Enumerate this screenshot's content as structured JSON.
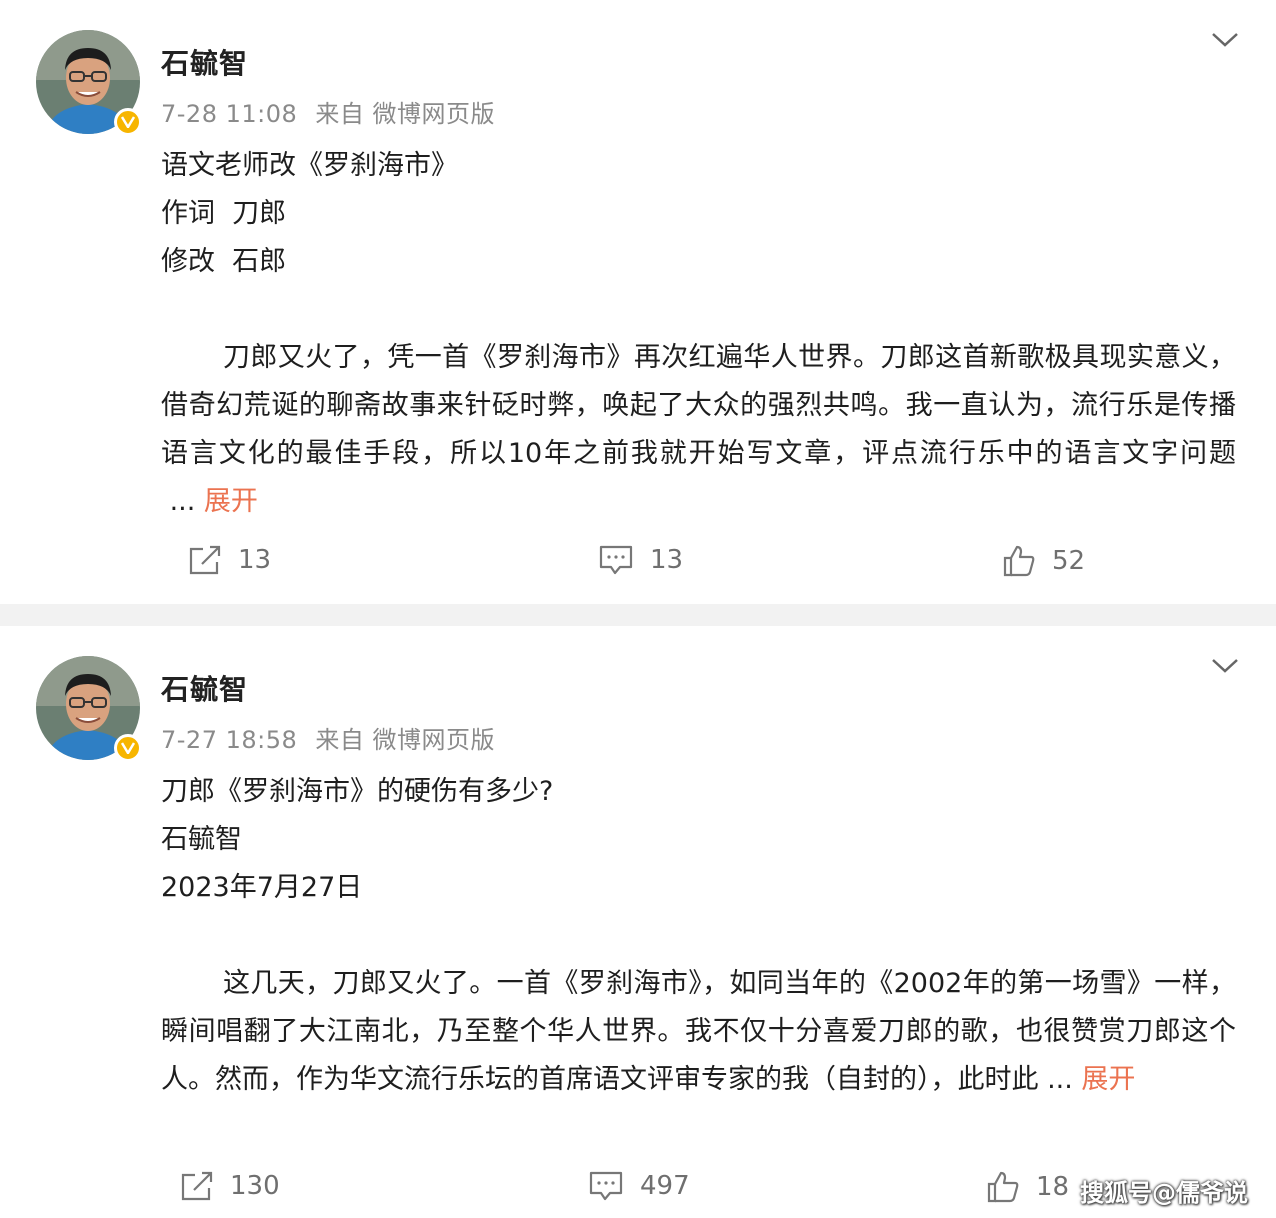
{
  "posts": [
    {
      "author": "石毓智",
      "time": "7-28 11:08",
      "source": "来自 微博网页版",
      "lines": [
        "语文老师改《罗刹海市》",
        "作词  刀郎",
        "修改  石郎"
      ],
      "body": "刀郎又火了，凭一首《罗刹海市》再次红遍华人世界。刀郎这首新歌极具现实意义，借奇幻荒诞的聊斋故事来针砭时弊，唤起了大众的强烈共鸣。我一直认为，流行乐是传播语言文化的最佳手段，所以10年之前我就开始写文章，评点流行乐中的语言文字问题",
      "ellipsis": " ... ",
      "expand_label": "展开",
      "reposts": "13",
      "comments": "13",
      "likes": "52"
    },
    {
      "author": "石毓智",
      "time": "7-27 18:58",
      "source": "来自 微博网页版",
      "lines": [
        "刀郎《罗刹海市》的硬伤有多少?",
        "石毓智",
        "2023年7月27日"
      ],
      "body": "这几天，刀郎又火了。一首《罗刹海市》，如同当年的《2002年的第一场雪》一样，瞬间唱翻了大江南北，乃至整个华人世界。我不仅十分喜爱刀郎的歌，也很赞赏刀郎这个人。然而，作为华文流行乐坛的首席语文评审专家的我（自封的），此时此",
      "ellipsis": " ... ",
      "expand_label": "展开",
      "reposts": "130",
      "comments": "497",
      "likes": "18"
    }
  ],
  "watermark": "搜狐号@儒爷说",
  "icons": {
    "repost": "repost-icon",
    "comment": "comment-icon",
    "like": "thumbs-up-icon",
    "more": "chevron-down-icon",
    "verified": "verified-badge-icon"
  },
  "colors": {
    "expand": "#eb7350",
    "meta": "#8a8a8a",
    "verified": "#f7b500",
    "separator": "#f2f2f2"
  }
}
